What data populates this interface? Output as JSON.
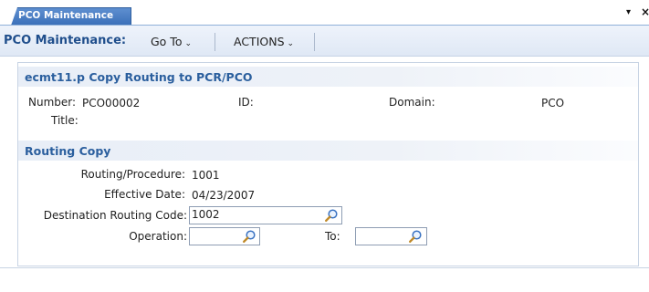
{
  "window": {
    "tab_label": "PCO Maintenance",
    "menu_glyph": "▾",
    "close_glyph": "×"
  },
  "toolbar": {
    "title": "PCO Maintenance:",
    "menus": [
      {
        "label": "Go To",
        "caret": "⌄"
      },
      {
        "label": "ACTIONS",
        "caret": "⌄"
      }
    ]
  },
  "form": {
    "header_title": "ecmt11.p  Copy Routing to PCR/PCO",
    "number_label": "Number:",
    "number_value": "PCO00002",
    "id_label": "ID:",
    "id_value": "",
    "domain_label": "Domain:",
    "domain_value": "PCO",
    "title_label": "Title:",
    "title_value": ""
  },
  "routing_copy": {
    "section_title": "Routing Copy",
    "routing_label": "Routing/Procedure:",
    "routing_value": "1001",
    "effective_label": "Effective Date:",
    "effective_value": "04/23/2007",
    "dest_label": "Destination Routing Code:",
    "dest_value": "1002",
    "operation_label": "Operation:",
    "operation_value": "",
    "to_label": "To:",
    "to_value": ""
  },
  "colors": {
    "accent": "#3a6fb8",
    "section_text": "#2b5f9e",
    "toolbar_title": "#1f4e8c"
  },
  "icons": {
    "lookup": "magnifier-icon"
  }
}
